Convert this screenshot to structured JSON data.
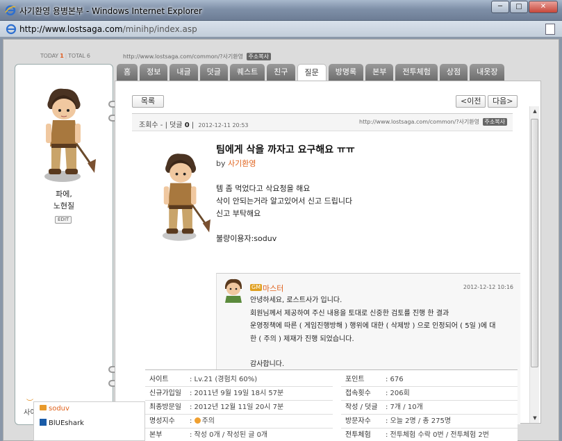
{
  "window": {
    "title": "사기환영 용병본부 - Windows Internet Explorer",
    "minimize": "─",
    "maximize": "□",
    "close": "✕"
  },
  "address": {
    "url_domain": "http://www.lostsaga.com",
    "url_path": "/minihp/index.asp"
  },
  "header": {
    "today_label": "TODAY",
    "today_count": "1",
    "total_label": "TOTAL",
    "total_count": "6",
    "home_url": "http://www.lostsaga.com/common/?사기환영",
    "copy_button": "주소복사"
  },
  "profile": {
    "name_line1": "파에,",
    "name_line2": "노현질",
    "edit": "EDIT",
    "partial_label": "사이"
  },
  "tabs": [
    {
      "label": "홈",
      "active": false
    },
    {
      "label": "정보",
      "active": false
    },
    {
      "label": "내글",
      "active": false
    },
    {
      "label": "덧글",
      "active": false
    },
    {
      "label": "퀘스트",
      "active": false
    },
    {
      "label": "친구",
      "active": false
    },
    {
      "label": "질문",
      "active": true
    },
    {
      "label": "방명록",
      "active": false
    },
    {
      "label": "본부",
      "active": false
    },
    {
      "label": "전투체험",
      "active": false
    },
    {
      "label": "상점",
      "active": false
    },
    {
      "label": "내옷장",
      "active": false
    }
  ],
  "post": {
    "list_button": "목록",
    "prev_button": "<이전",
    "next_button": "다음>",
    "views_label": "조회수 -",
    "comments_label": "덧글",
    "comments_count": "0",
    "date": "2012-12-11 20:53",
    "url": "http://www.lostsaga.com/common/?사기환영",
    "copy_button": "주소복사",
    "title": "팀에게 삭을 까자고 요구해요 ㅠㅠ",
    "by_label": "by",
    "author": "사기환영",
    "body_lines": [
      "템 좀 먹었다고 삭요청을 해요",
      "삭이 안되는거라 알고있어서 신고 드립니다",
      "신고 부탁해요"
    ],
    "reported_user": "불량이용자:soduv"
  },
  "reply": {
    "badge": "GM",
    "name": "마스터",
    "date": "2012-12-12 10:16",
    "lines": [
      "안녕하세요, 로스트사가 입니다.",
      "회원님께서 제공하여 주신 내용을 토대로 신중한 검토를 진행 한 결과",
      "운영정책에 따른 ( 게임진행방해 ) 행위에 대한 ( 삭제방 ) 으로 인정되어 ( 5일 )에 대",
      "한 ( 주의 ) 제재가 진행 되었습니다.",
      "",
      "감사합니다."
    ]
  },
  "info": {
    "left": [
      {
        "label": "사이트",
        "value": ": Lv.21 (경험치 60%)"
      },
      {
        "label": "신규가입일",
        "value": ": 2011년 9월 19일 18시 57분"
      },
      {
        "label": "최종방문일",
        "value": ": 2012년 12월 11일 20시 7분"
      },
      {
        "label": "명성지수",
        "value": "주의",
        "prefix": ": "
      },
      {
        "label": "본부",
        "value": ": 작성 0개 / 작성된 글 0개"
      }
    ],
    "right": [
      {
        "label": "포인트",
        "value": ": 676"
      },
      {
        "label": "접속횟수",
        "value": ": 206회"
      },
      {
        "label": "작성 / 덧글",
        "value": ": 7개 / 10개"
      },
      {
        "label": "방문자수",
        "value": ": 오늘 2명 / 총 275명"
      },
      {
        "label": "전투체험",
        "value": ": 전투체험 수락 0번 / 전투체험 2번"
      }
    ]
  },
  "friends": [
    {
      "name": "soduv"
    },
    {
      "name": "BlUEshark"
    }
  ]
}
